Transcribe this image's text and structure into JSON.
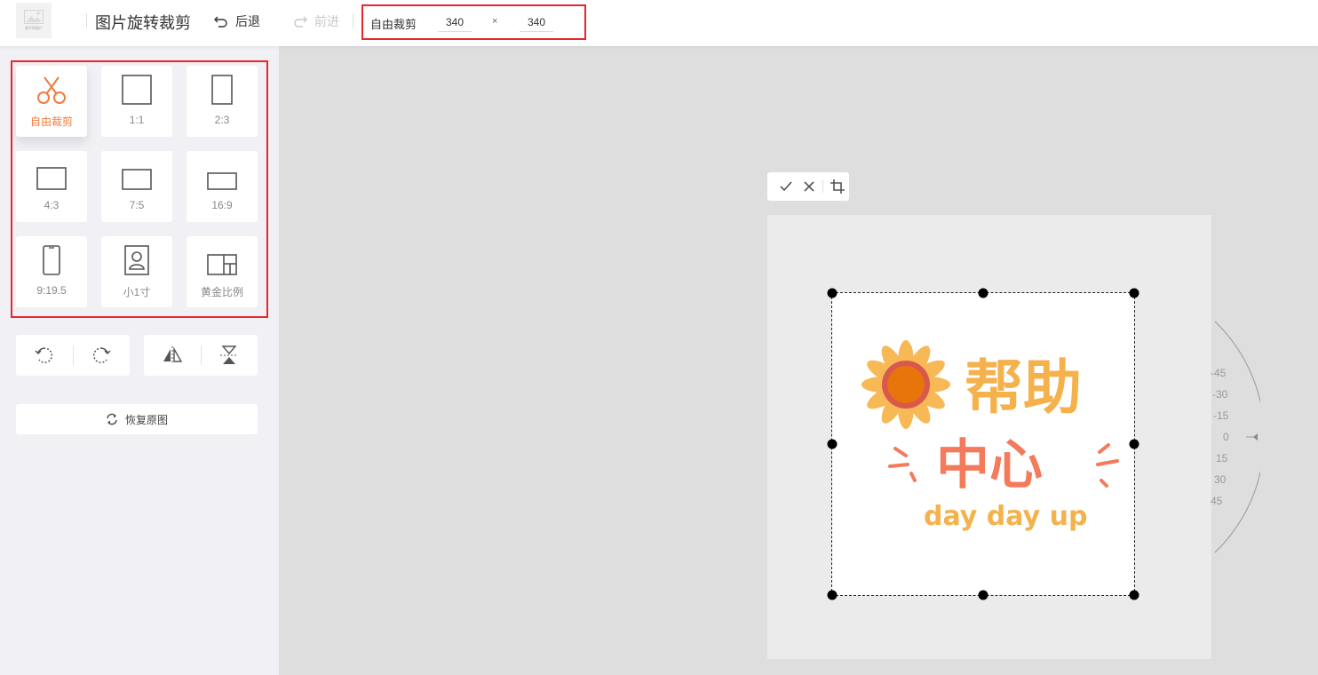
{
  "topbar": {
    "logo_text": "高手帮图片",
    "title": "图片旋转裁剪",
    "undo_label": "后退",
    "redo_label": "前进",
    "size": {
      "label": "自由裁剪",
      "width": "340",
      "times": "×",
      "height": "340"
    }
  },
  "sidebar": {
    "ratios": [
      {
        "label": "自由裁剪",
        "icon": "scissors-icon",
        "active": true
      },
      {
        "label": "1:1",
        "icon": "square-1-1-icon"
      },
      {
        "label": "2:3",
        "icon": "portrait-2-3-icon"
      },
      {
        "label": "4:3",
        "icon": "landscape-4-3-icon"
      },
      {
        "label": "7:5",
        "icon": "landscape-7-5-icon"
      },
      {
        "label": "16:9",
        "icon": "landscape-16-9-icon"
      },
      {
        "label": "9:19.5",
        "icon": "phone-9-19-5-icon"
      },
      {
        "label": "小1寸",
        "icon": "id-photo-icon"
      },
      {
        "label": "黄金比例",
        "icon": "golden-ratio-icon"
      }
    ],
    "reset_label": "恢复原图"
  },
  "canvas": {
    "dial_ticks": [
      "-45",
      "-30",
      "-15",
      "0",
      "15",
      "30",
      "45"
    ],
    "image_text": {
      "line1": "帮助",
      "line2": "中心",
      "line3": "day day up"
    }
  },
  "colors": {
    "accent": "#f07b3f",
    "highlight_border": "#e8262b",
    "sun_petal": "#f7b955",
    "sun_core": "#e8740c",
    "title_orange": "#f5b14c",
    "title_coral": "#f47a5c"
  }
}
